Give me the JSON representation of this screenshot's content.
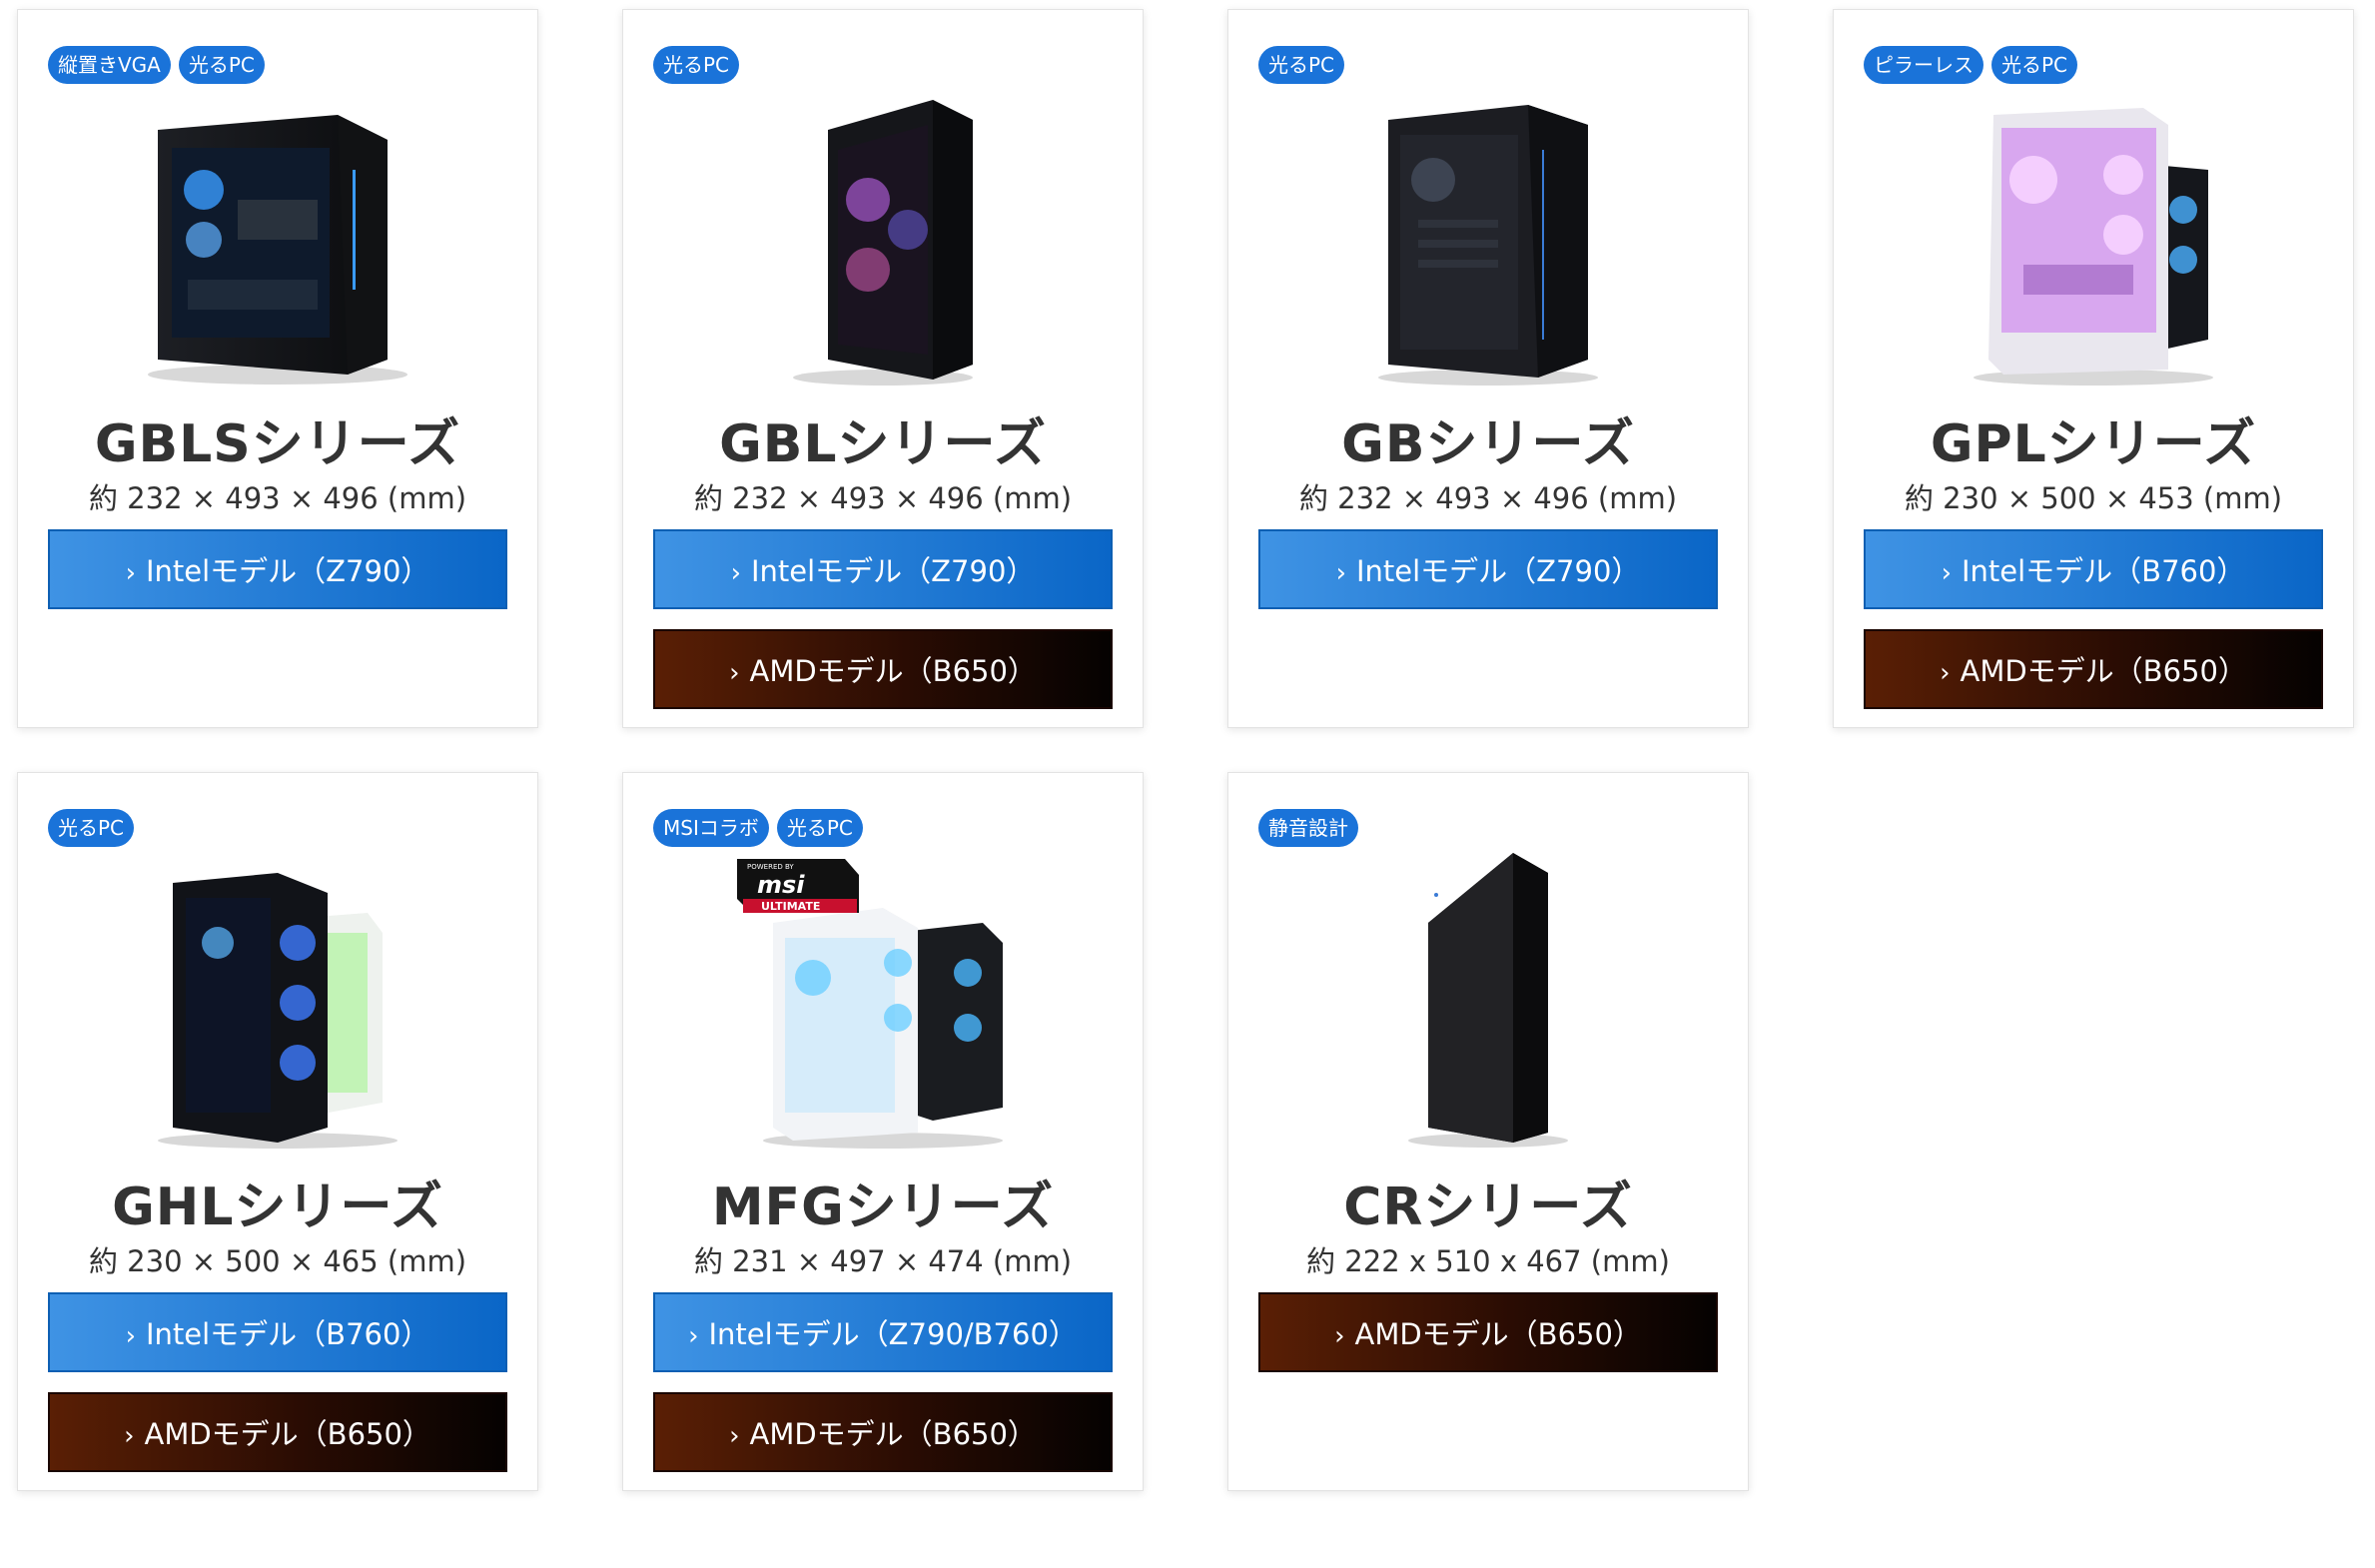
{
  "cards": [
    {
      "tags": [
        "縦置きVGA",
        "光るPC"
      ],
      "name": "GBLSシリーズ",
      "dims": "約 232 × 493 × 496 (mm)",
      "buttons": [
        {
          "label": "Intelモデル（Z790）",
          "type": "intel"
        }
      ]
    },
    {
      "tags": [
        "光るPC"
      ],
      "name": "GBLシリーズ",
      "dims": "約 232 × 493 × 496 (mm)",
      "buttons": [
        {
          "label": "Intelモデル（Z790）",
          "type": "intel"
        },
        {
          "label": "AMDモデル（B650）",
          "type": "amd"
        }
      ]
    },
    {
      "tags": [
        "光るPC"
      ],
      "name": "GBシリーズ",
      "dims": "約 232 × 493 × 496 (mm)",
      "buttons": [
        {
          "label": "Intelモデル（Z790）",
          "type": "intel"
        }
      ]
    },
    {
      "tags": [
        "ピラーレス",
        "光るPC"
      ],
      "name": "GPLシリーズ",
      "dims": "約 230 × 500 × 453 (mm)",
      "buttons": [
        {
          "label": "Intelモデル（B760）",
          "type": "intel"
        },
        {
          "label": "AMDモデル（B650）",
          "type": "amd"
        }
      ]
    },
    {
      "tags": [
        "光るPC"
      ],
      "name": "GHLシリーズ",
      "dims": "約 230 × 500 × 465 (mm)",
      "buttons": [
        {
          "label": "Intelモデル（B760）",
          "type": "intel"
        },
        {
          "label": "AMDモデル（B650）",
          "type": "amd"
        }
      ]
    },
    {
      "tags": [
        "MSIコラボ",
        "光るPC"
      ],
      "name": "MFGシリーズ",
      "dims": "約 231 × 497 × 474 (mm)",
      "buttons": [
        {
          "label": "Intelモデル（Z790/B760）",
          "type": "intel"
        },
        {
          "label": "AMDモデル（B650）",
          "type": "amd"
        }
      ],
      "logo": {
        "top": "POWERED BY",
        "brand": "msi",
        "bottom": "ULTIMATE"
      }
    },
    {
      "tags": [
        "静音設計"
      ],
      "name": "CRシリーズ",
      "dims": "約 222 x 510 x 467 (mm)",
      "buttons": [
        {
          "label": "AMDモデル（B650）",
          "type": "amd"
        }
      ]
    }
  ],
  "chevron": "›",
  "colors": {
    "tag": "#1a73d9",
    "intel_button": "#1c7bd8",
    "amd_button": "#3a1206",
    "text": "#333333"
  }
}
